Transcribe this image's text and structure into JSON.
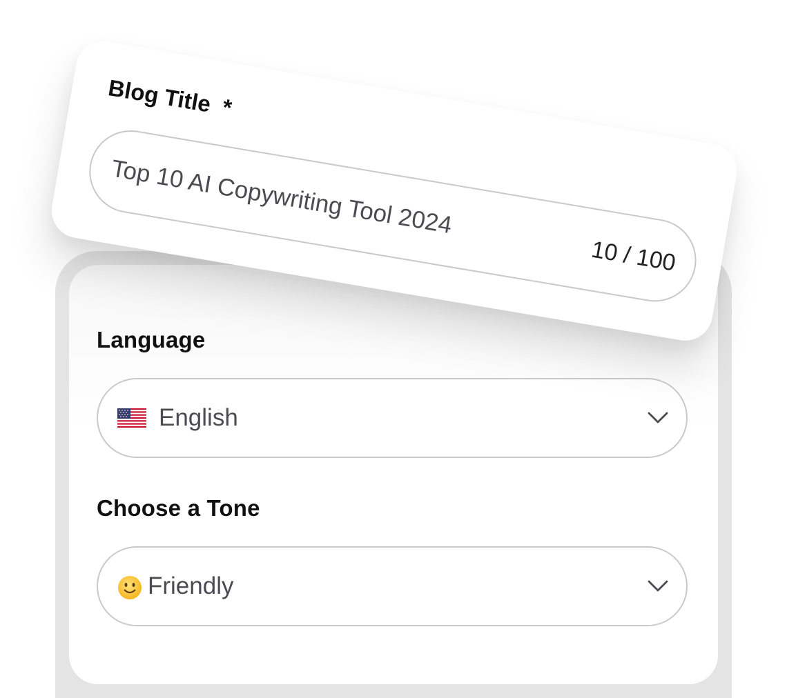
{
  "blog_title": {
    "label": "Blog Title",
    "required_marker": "*",
    "value": "Top 10 AI Copywriting Tool 2024",
    "counter": "10 / 100"
  },
  "language": {
    "label": "Language",
    "selected": "English",
    "flag_icon": "us-flag-icon"
  },
  "tone": {
    "label": "Choose a Tone",
    "selected": "Friendly",
    "emoji_icon": "slightly-smiling-face-icon"
  },
  "colors": {
    "panel_border": "#e4e4e4",
    "input_border": "#c9c9c9",
    "value_text": "#4b4b52"
  }
}
